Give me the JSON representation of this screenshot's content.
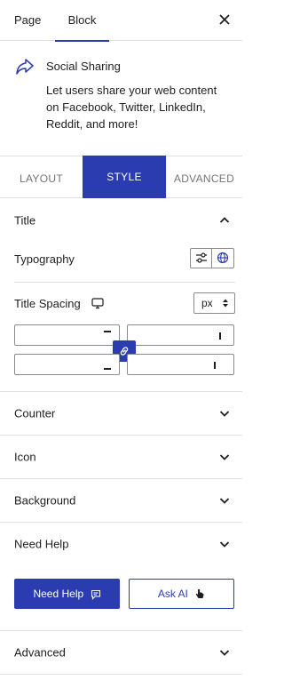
{
  "header": {
    "tabs": [
      {
        "label": "Page",
        "active": false
      },
      {
        "label": "Block",
        "active": true
      }
    ],
    "close_icon": "close-icon"
  },
  "block": {
    "icon": "share-arrow-icon",
    "title": "Social Sharing",
    "description": "Let users share your web content on Facebook, Twitter, LinkedIn, Reddit, and more!"
  },
  "panel_tabs": [
    {
      "label": "LAYOUT",
      "active": false
    },
    {
      "label": "STYLE",
      "active": true
    },
    {
      "label": "ADVANCED",
      "active": false
    }
  ],
  "title_section": {
    "label": "Title",
    "expanded": true,
    "typography_label": "Typography",
    "typography_icons": [
      "sliders-icon",
      "globe-icon"
    ],
    "spacing_label": "Title Spacing",
    "device_icon": "desktop-icon",
    "unit": "px",
    "spacing_values": {
      "top": "",
      "right": "",
      "bottom": "",
      "left": ""
    },
    "link_icon": "link-icon"
  },
  "sections": [
    {
      "label": "Counter",
      "expanded": false
    },
    {
      "label": "Icon",
      "expanded": false
    },
    {
      "label": "Background",
      "expanded": false
    },
    {
      "label": "Need Help",
      "expanded": true
    }
  ],
  "help_buttons": {
    "need_help": "Need Help",
    "need_help_icon": "chat-icon",
    "ask_ai": "Ask AI",
    "ask_ai_icon": "pointer-hand-icon"
  },
  "advanced_section": {
    "label": "Advanced",
    "expanded": false
  },
  "colors": {
    "accent": "#2b3bb0",
    "border": "#e0e0e0",
    "text": "#1e1e1e",
    "muted": "#757575"
  }
}
